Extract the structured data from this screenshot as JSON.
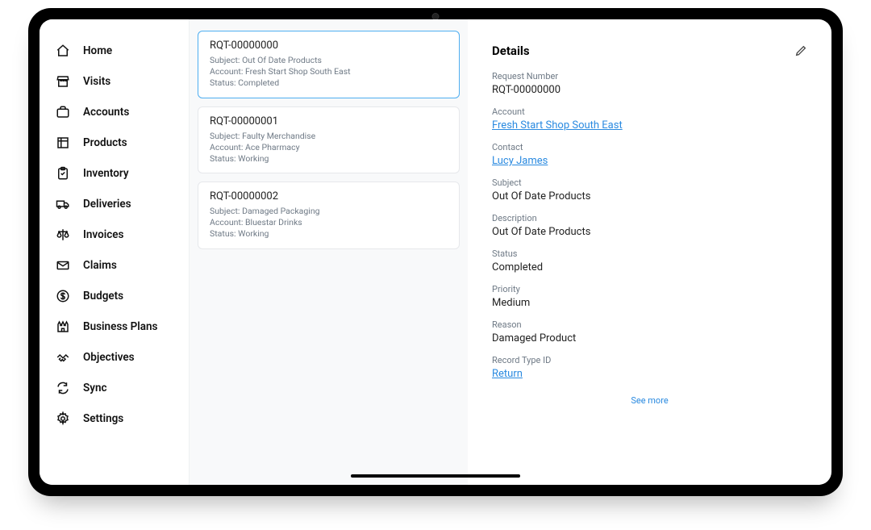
{
  "sidebar": {
    "items": [
      {
        "label": "Home"
      },
      {
        "label": "Visits"
      },
      {
        "label": "Accounts"
      },
      {
        "label": "Products"
      },
      {
        "label": "Inventory"
      },
      {
        "label": "Deliveries"
      },
      {
        "label": "Invoices"
      },
      {
        "label": "Claims"
      },
      {
        "label": "Budgets"
      },
      {
        "label": "Business Plans"
      },
      {
        "label": "Objectives"
      },
      {
        "label": "Sync"
      },
      {
        "label": "Settings"
      }
    ]
  },
  "list": {
    "subject_prefix": "Subject:",
    "account_prefix": "Account:",
    "status_prefix": "Status:",
    "cards": [
      {
        "id": "RQT-00000000",
        "subject": "Out Of Date Products",
        "account": "Fresh Start Shop South East",
        "status": "Completed",
        "selected": true
      },
      {
        "id": "RQT-00000001",
        "subject": "Faulty Merchandise",
        "account": "Ace Pharmacy",
        "status": "Working",
        "selected": false
      },
      {
        "id": "RQT-00000002",
        "subject": "Damaged Packaging",
        "account": "Bluestar Drinks",
        "status": "Working",
        "selected": false
      }
    ]
  },
  "details": {
    "title": "Details",
    "see_more": "See more",
    "fields": {
      "request_number": {
        "label": "Request Number",
        "value": "RQT-00000000"
      },
      "account": {
        "label": "Account",
        "value": "Fresh Start Shop South East",
        "link": true
      },
      "contact": {
        "label": "Contact",
        "value": "Lucy James",
        "link": true
      },
      "subject": {
        "label": "Subject",
        "value": "Out Of Date Products"
      },
      "description": {
        "label": "Description",
        "value": "Out Of Date Products"
      },
      "status": {
        "label": "Status",
        "value": "Completed"
      },
      "priority": {
        "label": "Priority",
        "value": "Medium"
      },
      "reason": {
        "label": "Reason",
        "value": "Damaged Product"
      },
      "record_type_id": {
        "label": "Record Type ID",
        "value": "Return",
        "link": true
      }
    }
  }
}
